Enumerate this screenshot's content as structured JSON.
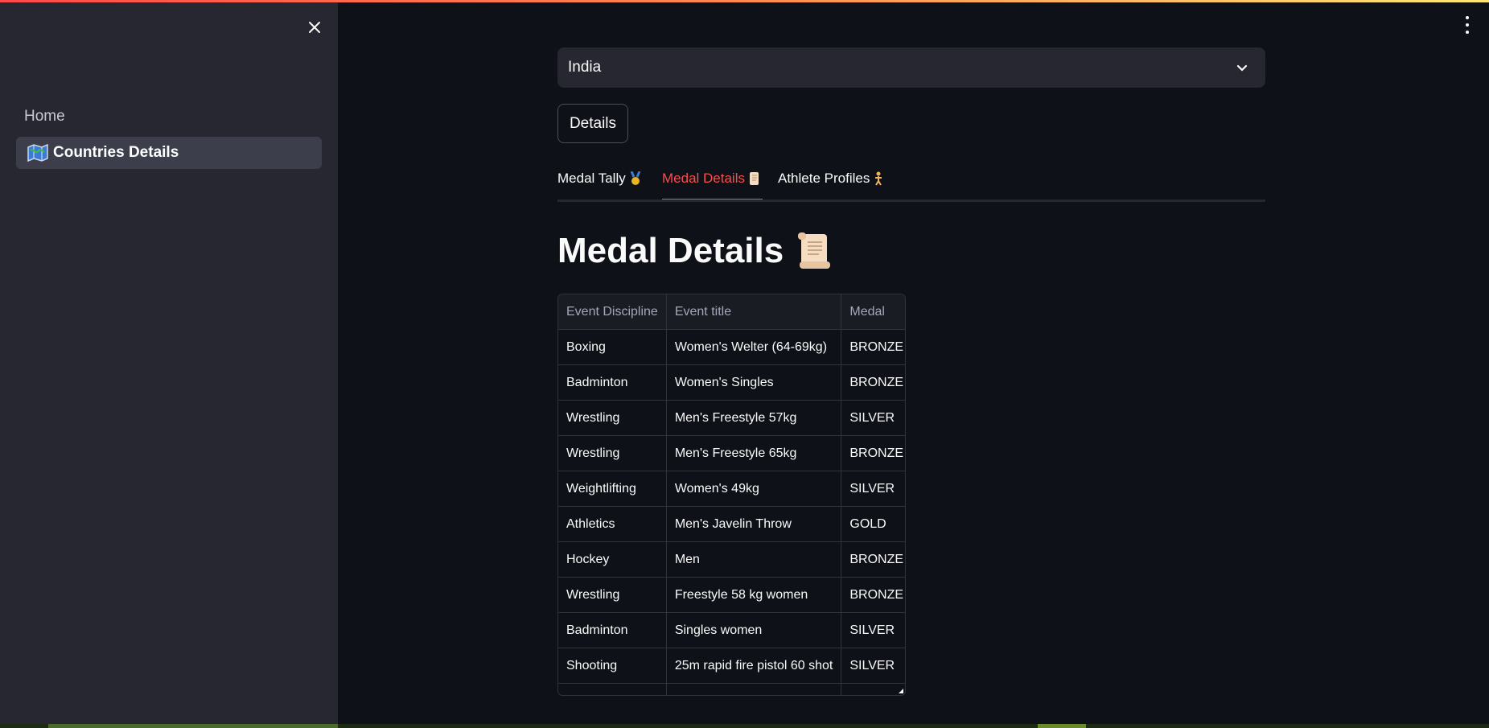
{
  "sidebar": {
    "nav": [
      {
        "label": "Home",
        "active": false
      },
      {
        "label": "Countries Details",
        "active": true,
        "icon": "map-icon"
      }
    ],
    "close_icon": "close-icon"
  },
  "main": {
    "country_select": {
      "value": "India",
      "icon": "chevron-down-icon"
    },
    "details_button": "Details",
    "tabs": [
      {
        "label": "Medal Tally",
        "icon": "medal-icon",
        "active": false
      },
      {
        "label": "Medal Details",
        "icon": "scroll-icon",
        "active": true
      },
      {
        "label": "Athlete Profiles",
        "icon": "athlete-icon",
        "active": false
      }
    ],
    "heading": "Medal Details",
    "table": {
      "columns": [
        "Event Discipline",
        "Event title",
        "Medal"
      ],
      "rows": [
        [
          "Boxing",
          "Women's Welter (64-69kg)",
          "BRONZE"
        ],
        [
          "Badminton",
          "Women's Singles",
          "BRONZE"
        ],
        [
          "Wrestling",
          "Men's Freestyle 57kg",
          "SILVER"
        ],
        [
          "Wrestling",
          "Men's Freestyle 65kg",
          "BRONZE"
        ],
        [
          "Weightlifting",
          "Women's 49kg",
          "SILVER"
        ],
        [
          "Athletics",
          "Men's Javelin Throw",
          "GOLD"
        ],
        [
          "Hockey",
          "Men",
          "BRONZE"
        ],
        [
          "Wrestling",
          "Freestyle 58 kg women",
          "BRONZE"
        ],
        [
          "Badminton",
          "Singles women",
          "SILVER"
        ],
        [
          "Shooting",
          "25m rapid fire pistol 60 shot",
          "SILVER"
        ]
      ]
    }
  },
  "colors": {
    "accent": "#ff4b4b",
    "background": "#0e1117",
    "sidebar": "#262730"
  }
}
